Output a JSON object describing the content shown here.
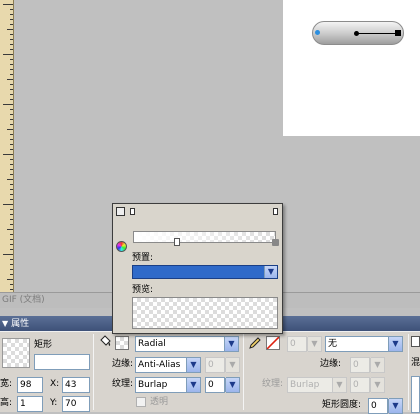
{
  "status_bar": {
    "text": "GIF (文档)"
  },
  "panel": {
    "title": "属性"
  },
  "shape": {
    "type": "矩形",
    "name_value": ""
  },
  "geometry": {
    "w_label": "宽:",
    "w_value": "98",
    "h_label": "高:",
    "h_value": "1",
    "x_label": "X:",
    "x_value": "43",
    "y_label": "Y:",
    "y_value": "70"
  },
  "fill": {
    "type": "Radial",
    "edge_label": "边缘:",
    "edge_value": "Anti-Alias",
    "edge_amount": "0",
    "texture_label": "纹理:",
    "texture_value": "Burlap",
    "texture_amount": "0",
    "transparent_label": "透明"
  },
  "stroke": {
    "amount": "0",
    "type": "无",
    "edge_label": "边缘:",
    "edge_amount": "0",
    "texture_label": "纹理:",
    "texture_value": "Burlap",
    "texture_amount": "0",
    "roundness_label": "矩形圆度:",
    "roundness_value": "0"
  },
  "right_panel": {
    "blend_label": "混"
  },
  "gradient_popup": {
    "preset_label": "预置:",
    "preset_value": "",
    "preview_label": "预览:"
  },
  "colors": {
    "accent": "#2f6ac9",
    "panel_title": "#3e5178"
  },
  "icons": [
    "paint-bucket-icon",
    "pencil-icon",
    "no-color-icon",
    "color-wheel-icon",
    "lock-icon"
  ]
}
